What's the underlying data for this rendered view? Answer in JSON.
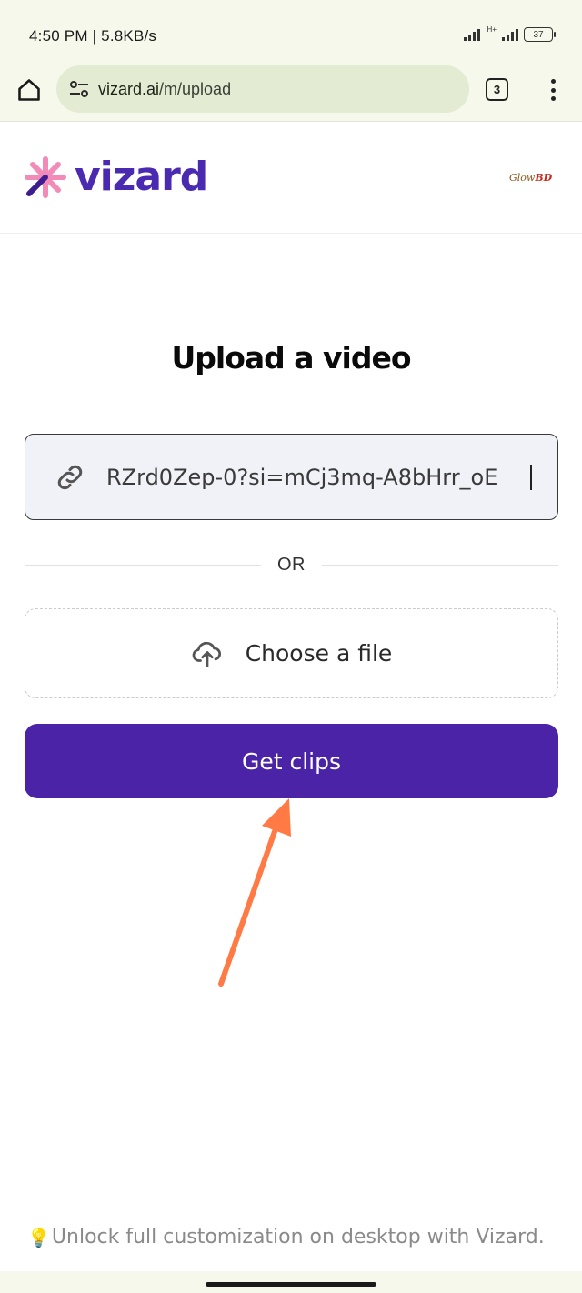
{
  "status_bar": {
    "time": "4:50 PM | 5.8KB/s",
    "network_type": "H+",
    "battery": "37"
  },
  "browser": {
    "url_host": "vizard.ai",
    "url_path": "/m/upload",
    "tab_count": "3",
    "home_icon": "home-icon",
    "site_settings_icon": "tune-icon",
    "menu_icon": "more-vert-icon"
  },
  "site": {
    "brand": "vizard",
    "brand_color": "#4a2ab0",
    "avatar_text_1": "Glow",
    "avatar_text_2": "BD"
  },
  "main": {
    "title": "Upload a video",
    "link_input_value": "RZrd0Zep-0?si=mCj3mq-A8bHrr_oE",
    "divider_text": "OR",
    "file_picker_label": "Choose a file",
    "primary_button_label": "Get clips",
    "primary_color": "#4a23a7"
  },
  "annotation": {
    "arrow_color": "#ff7a45"
  },
  "footer": {
    "tip_icon": "💡",
    "tip_text": "Unlock full customization on desktop with Vizard."
  }
}
